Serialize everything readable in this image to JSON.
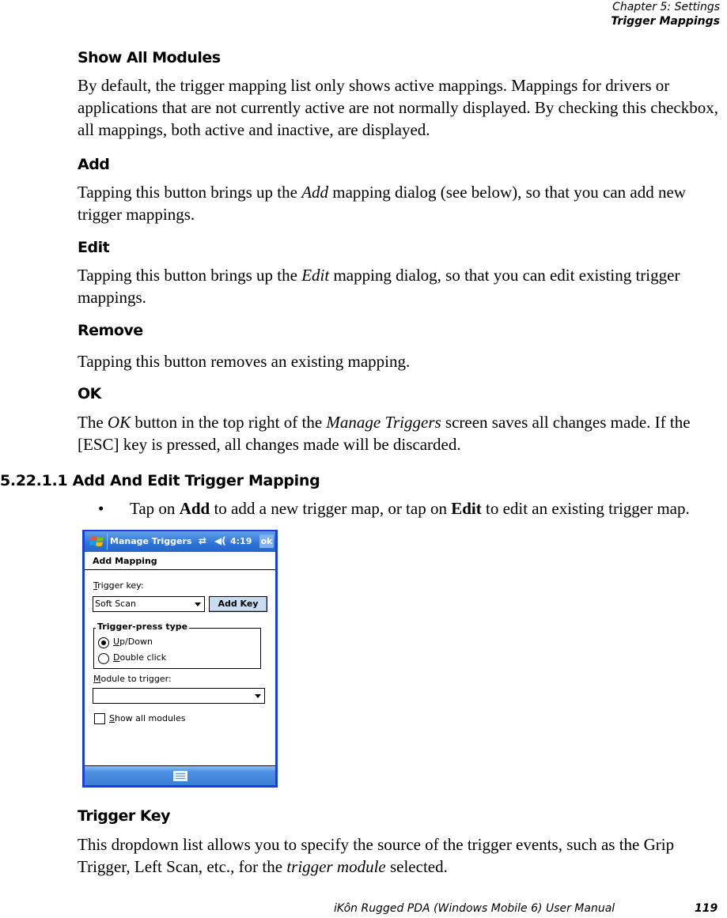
{
  "header": {
    "chapter": "Chapter 5:  Settings",
    "section": "Trigger Mappings"
  },
  "sections": [
    {
      "heading": "Show All Modules",
      "body": "By default, the trigger mapping list only shows active mappings. Mappings for drivers or applications that are not currently active are not normally displayed. By checking this checkbox, all mappings, both active and inactive, are displayed."
    },
    {
      "heading": "Add",
      "body_parts": [
        "Tapping this button brings up the ",
        "Add",
        " mapping dialog (see below), so that you can add new trigger mappings."
      ]
    },
    {
      "heading": "Edit",
      "body_parts": [
        "Tapping this button brings up the ",
        "Edit",
        " mapping dialog, so that you can edit existing trigger mappings."
      ]
    },
    {
      "heading": "Remove",
      "body": "Tapping this button removes an existing mapping."
    },
    {
      "heading": "OK",
      "body_parts": [
        "The ",
        "OK",
        " button in the top right of the ",
        "Manage Triggers",
        " screen saves all changes made. If the [ESC] key is pressed, all changes made will be discarded."
      ]
    }
  ],
  "subsection": {
    "number_title": "5.22.1.1 Add And Edit Trigger Mapping",
    "bullet": {
      "symbol": "•",
      "parts": [
        "Tap on ",
        "Add",
        " to add a new trigger map, or tap on ",
        "Edit",
        " to edit an existing trigger map."
      ]
    }
  },
  "device_screen": {
    "titlebar": {
      "start_icon": "windows-flag-icon",
      "title": "Manage Triggers",
      "connectivity_icon": "sync-arrows-icon",
      "volume_icon": "speaker-icon",
      "time": "4:19",
      "ok_label": "ok"
    },
    "dialog_title": "Add Mapping",
    "trigger_key_label_accel": "T",
    "trigger_key_label_rest": "rigger key:",
    "trigger_key_value": "Soft Scan",
    "add_key_label": "Add Key",
    "press_type_group": "Trigger-press type",
    "radio_updown_accel": "U",
    "radio_updown_rest": "p/Down",
    "radio_updown_selected": true,
    "radio_double_accel": "D",
    "radio_double_rest": "ouble click",
    "radio_double_selected": false,
    "module_label_accel": "M",
    "module_label_rest": "odule to trigger:",
    "module_value": "",
    "show_all_accel": "S",
    "show_all_rest": "how all modules",
    "show_all_checked": false,
    "keyboard_icon": "keyboard-icon",
    "colors": {
      "titlebar": "#2d73d6",
      "frame": "#1a3fd6",
      "button": "#c9dcf2"
    }
  },
  "trigger_key_section": {
    "heading": "Trigger Key",
    "body_parts": [
      "This dropdown list allows you to specify the source of the trigger events, such as the Grip Trigger, Left Scan, etc., for the ",
      "trigger module",
      " selected."
    ]
  },
  "footer": {
    "manual_title": "iKôn Rugged PDA (Windows Mobile 6) User Manual",
    "page_number": "119"
  }
}
